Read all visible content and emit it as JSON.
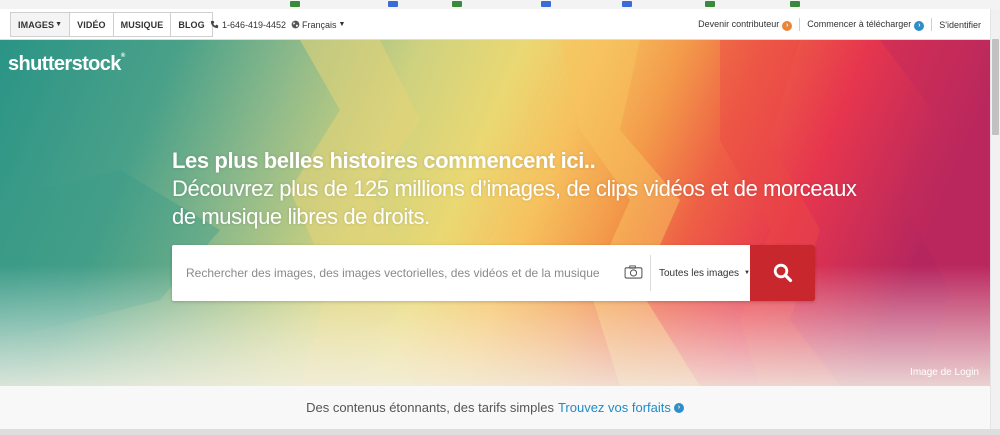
{
  "nav": {
    "tabs": [
      {
        "label": "IMAGES",
        "has_caret": true
      },
      {
        "label": "VIDÉO"
      },
      {
        "label": "MUSIQUE"
      },
      {
        "label": "BLOG"
      }
    ],
    "phone": "1-646-419-4452",
    "language": "Français",
    "contributor": "Devenir contributeur",
    "download": "Commencer à télécharger",
    "signin": "S'identifier"
  },
  "hero": {
    "logo": "shutterstock",
    "headline_line1": "Les plus belles histoires commencent ici..",
    "headline_line2": "Découvrez plus de 125 millions d’images, de clips vidéos et de morceaux de musique libres de droits.",
    "search_placeholder": "Rechercher des images, des images vectorielles, des vidéos et de la musique",
    "filter_label": "Toutes les images",
    "credit": "Image de Login"
  },
  "promo": {
    "text": "Des contenus étonnants, des tarifs simples",
    "link": "Trouvez vos forfaits"
  },
  "colors": {
    "search_button": "#c8282d",
    "link": "#1e8cc8",
    "contributor_badge": "#e8873a",
    "download_badge": "#2e8ec7"
  }
}
